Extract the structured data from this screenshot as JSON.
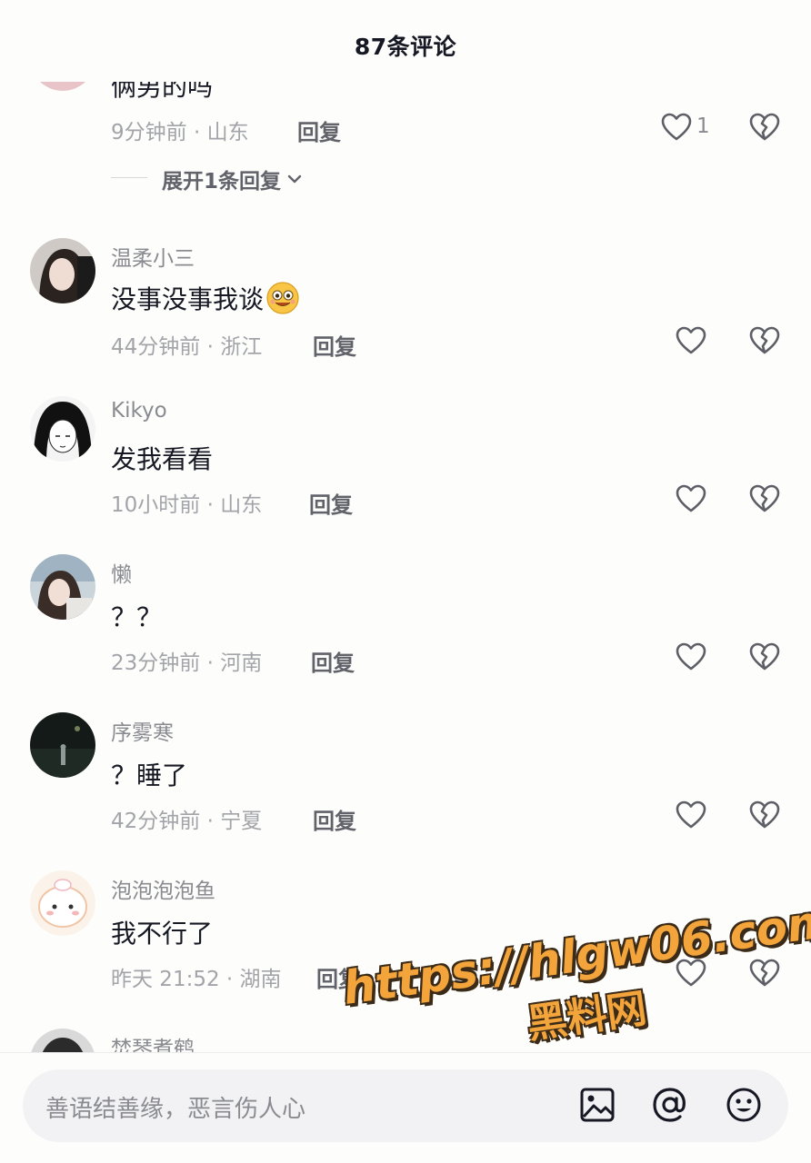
{
  "header": {
    "title": "87条评论"
  },
  "comments": [
    {
      "username": "",
      "text": "俩男的吗",
      "time_location": "9分钟前 · 山东",
      "reply_label": "回复",
      "like_count": "1",
      "expand_label": "展开1条回复"
    },
    {
      "username": "温柔小三",
      "text": "没事没事我谈",
      "time_location": "44分钟前 · 浙江",
      "reply_label": "回复"
    },
    {
      "username": "Kikyo",
      "text": "发我看看",
      "time_location": "10小时前 · 山东",
      "reply_label": "回复"
    },
    {
      "username": "懒",
      "text": "？？",
      "time_location": "23分钟前 · 河南",
      "reply_label": "回复"
    },
    {
      "username": "序雾寒",
      "text": "？睡了",
      "time_location": "42分钟前 · 宁夏",
      "reply_label": "回复"
    },
    {
      "username": "泡泡泡泡鱼",
      "text": "我不行了",
      "time_location": "昨天 21:52 · 湖南",
      "reply_label": "回复"
    },
    {
      "username": "焚琴煮鹤"
    }
  ],
  "input": {
    "placeholder": "善语结善缘，恶言伤人心"
  },
  "icons": [
    "heart-icon",
    "broken-heart-icon",
    "chevron-down-icon",
    "image-icon",
    "at-icon",
    "emoji-icon"
  ],
  "watermark": {
    "url": "https://hlgw06.com",
    "name": "黑料网"
  },
  "colors": {
    "text": "#161823",
    "secondary": "#8a8b91",
    "watermark": "#f3a43a"
  }
}
